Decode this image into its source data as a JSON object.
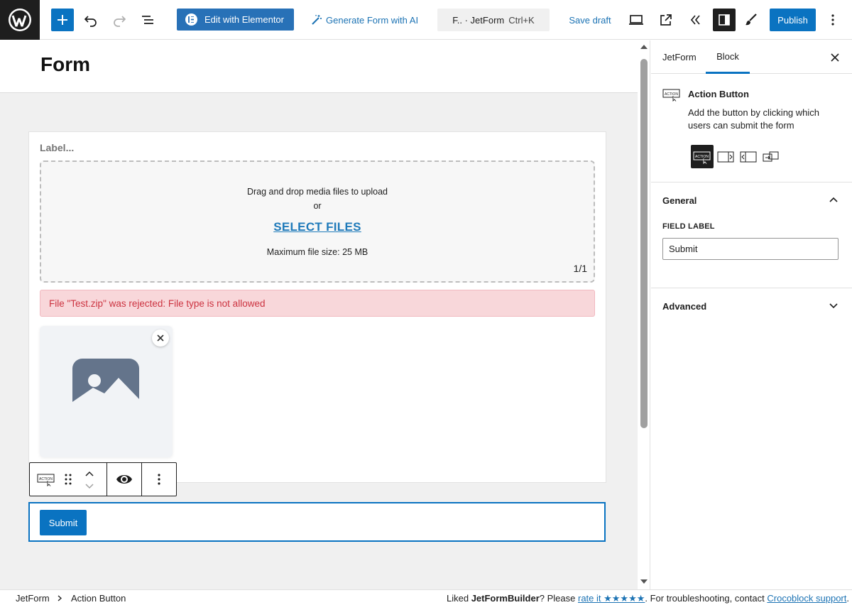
{
  "topbar": {
    "elementor_label": "Edit with Elementor",
    "ai_label": "Generate Form with AI",
    "command_title": "F.. · JetForm",
    "command_shortcut": "Ctrl+K",
    "save_draft": "Save draft",
    "publish": "Publish"
  },
  "editor": {
    "page_title": "Form",
    "field_label": "Label...",
    "dropzone_text": "Drag and drop media files to upload",
    "dropzone_or": "or",
    "select_files": "SELECT FILES",
    "max_size": "Maximum file size: 25 MB",
    "count": "1/1",
    "error": "File \"Test.zip\" was rejected: File type is not allowed",
    "submit_label": "Submit"
  },
  "sidebar": {
    "tabs": [
      "JetForm",
      "Block"
    ],
    "active_tab": "Block",
    "block_title": "Action Button",
    "block_desc": "Add the button by clicking which users can submit the form",
    "icon_text": "ACTION",
    "general": "General",
    "field_label_heading": "FIELD LABEL",
    "field_label_value": "Submit",
    "advanced": "Advanced"
  },
  "footer": {
    "crumbs": [
      "JetForm",
      "Action Button"
    ],
    "note_pre": "Liked ",
    "note_brand": "JetFormBuilder",
    "note_mid": "? Please ",
    "rate_link": "rate it ★★★★★",
    "note_post": ". For troubleshooting, contact ",
    "support_link": "Crocoblock support",
    "note_end": "."
  },
  "colors": {
    "accent": "#0a73c1",
    "error_bg": "#f8d7da",
    "error_text": "#cc3340"
  }
}
